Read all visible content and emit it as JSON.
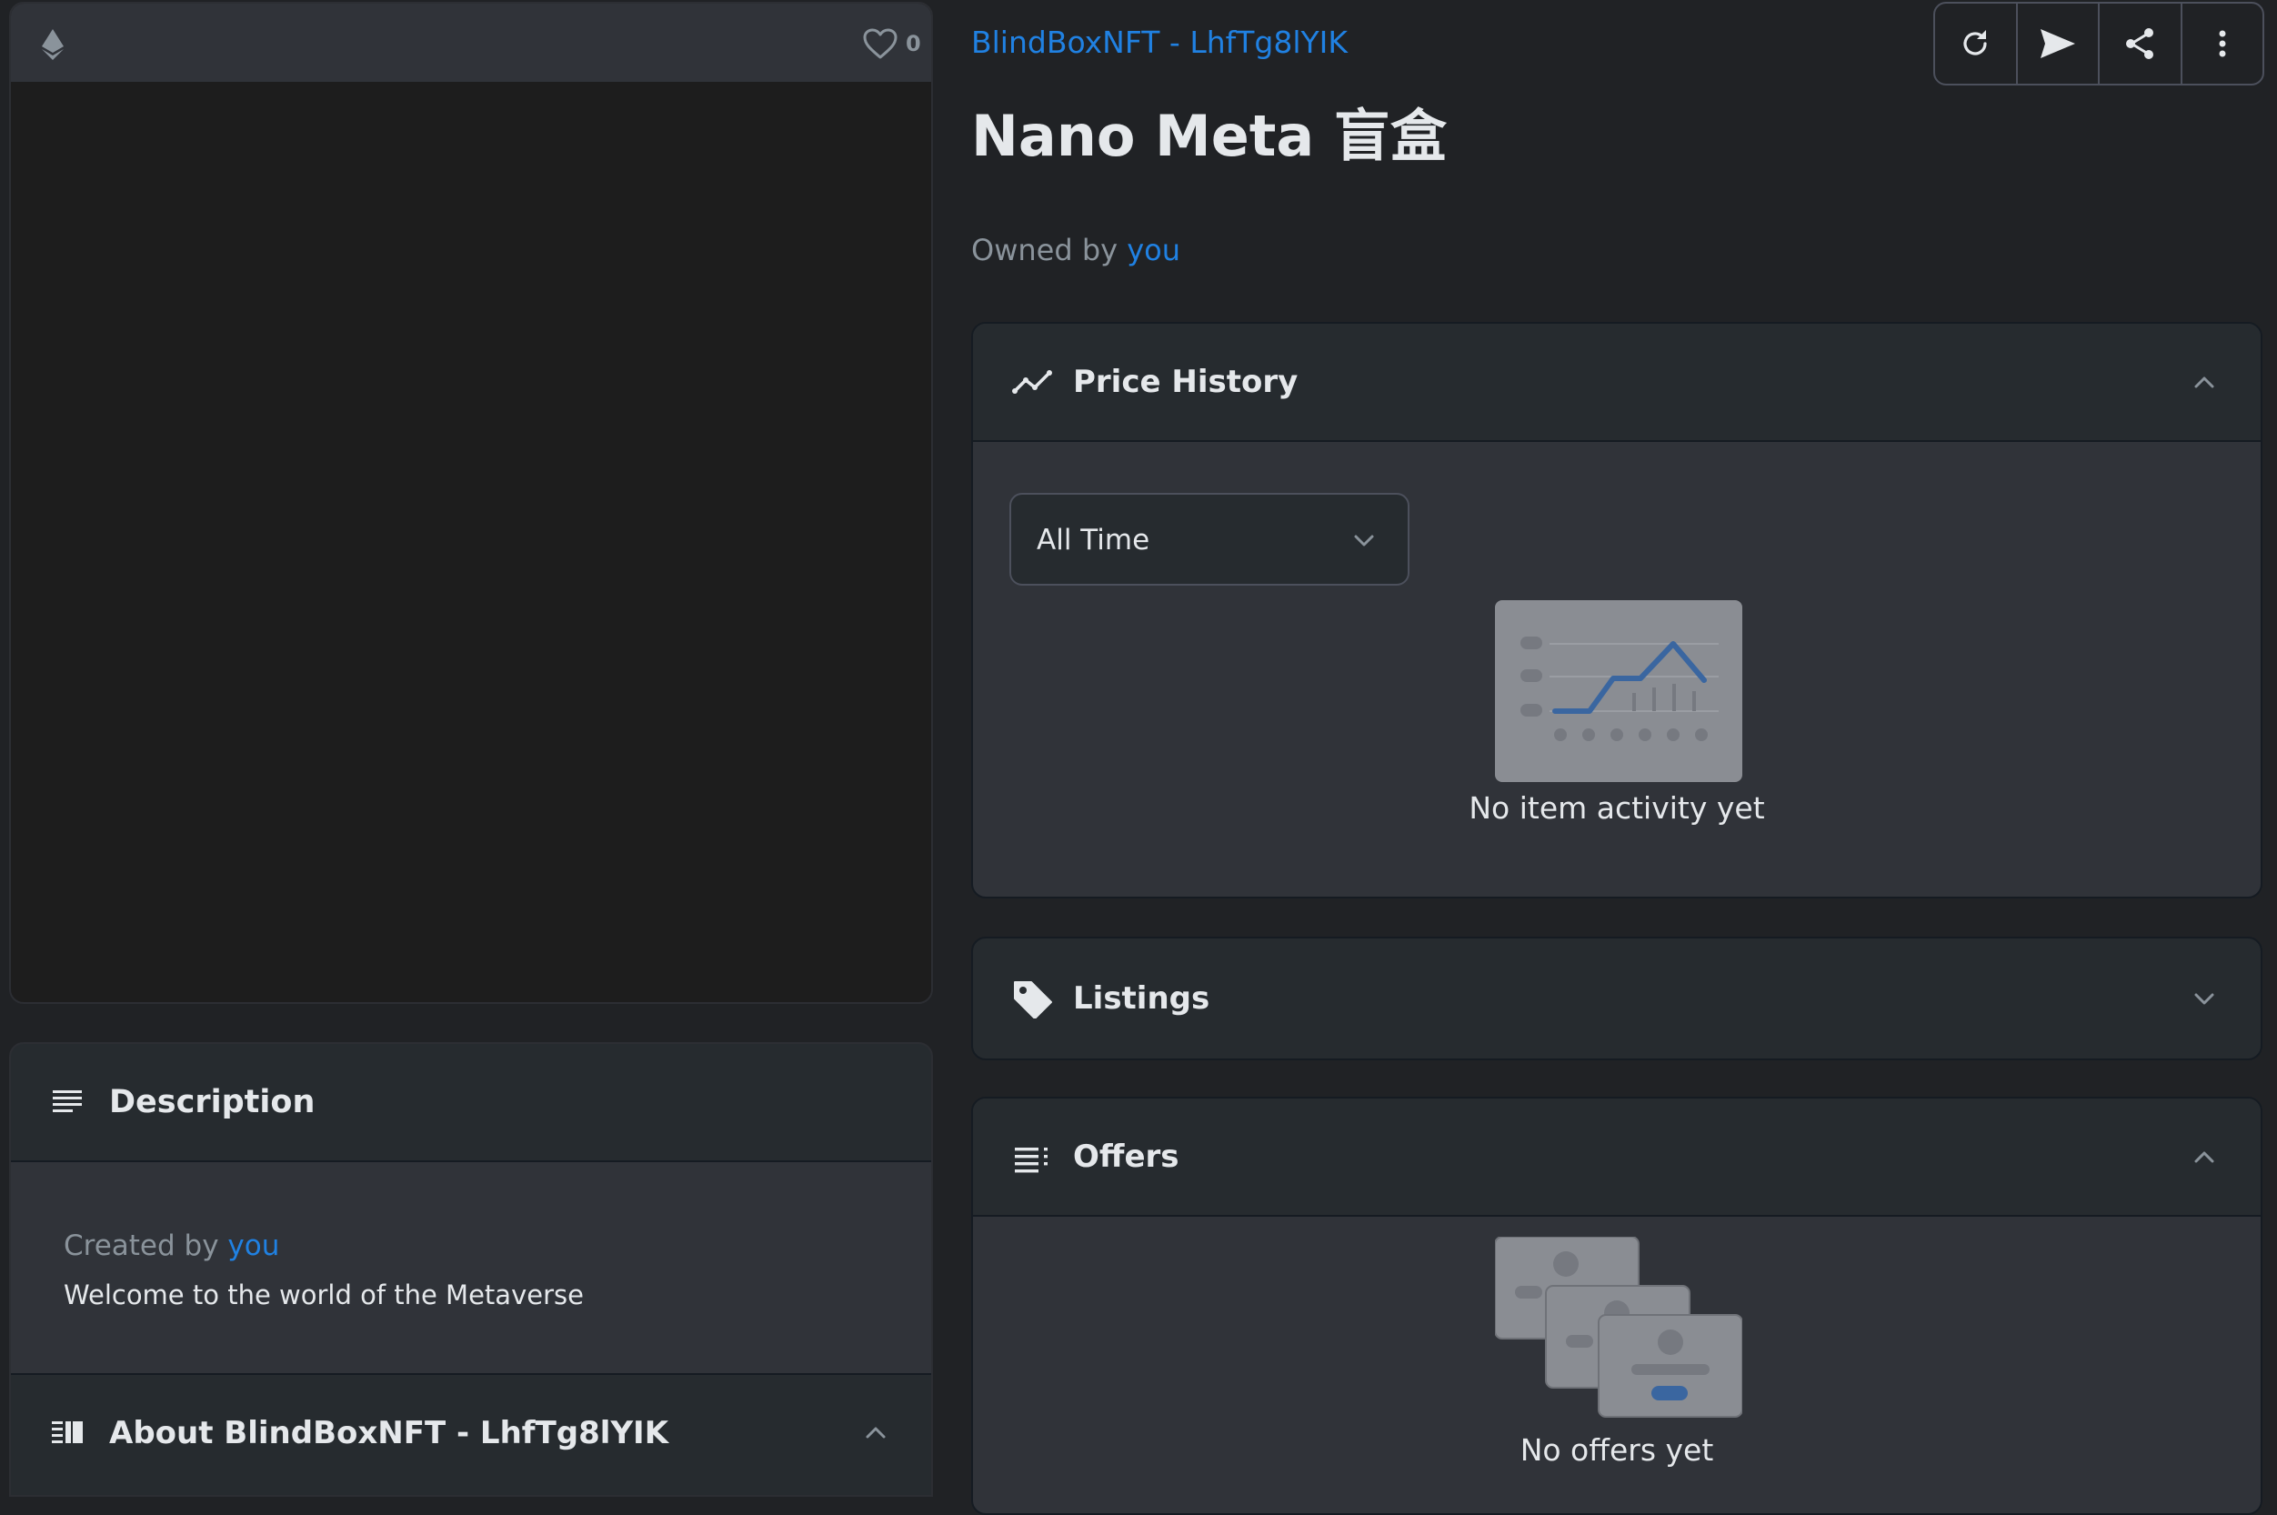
{
  "media": {
    "chain_icon": "ethereum-icon",
    "favorites_count": "0"
  },
  "description": {
    "title": "Description",
    "created_by_prefix": "Created by",
    "created_by_name": "you",
    "text": "Welcome to the world of the Metaverse"
  },
  "about": {
    "title": "About BlindBoxNFT - LhfTg8lYIK"
  },
  "item": {
    "collection": "BlindBoxNFT - LhfTg8lYIK",
    "title": "Nano Meta 盲盒",
    "owned_by_prefix": "Owned by",
    "owner": "you"
  },
  "toolbar": {
    "buttons": [
      "refresh-icon",
      "send-icon",
      "share-icon",
      "more-vertical-icon"
    ]
  },
  "price_history": {
    "title": "Price History",
    "filter_value": "All Time",
    "empty_text": "No item activity yet"
  },
  "listings": {
    "title": "Listings"
  },
  "offers": {
    "title": "Offers",
    "empty_text": "No offers yet"
  },
  "colors": {
    "background": "#202225",
    "panel": "#303339",
    "panel_header": "#262b2f",
    "link": "#2081e2",
    "muted_text": "#8a939b"
  }
}
